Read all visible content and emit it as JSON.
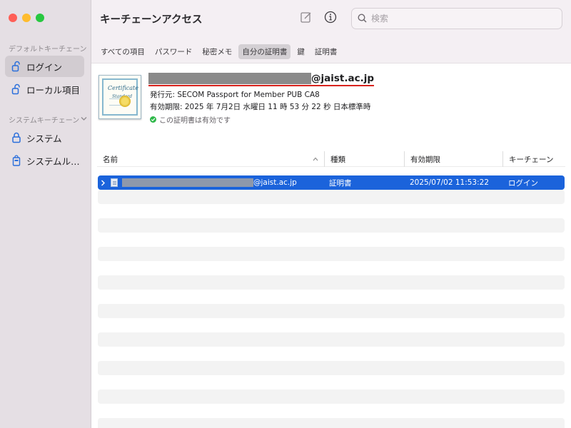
{
  "window": {
    "title": "キーチェーンアクセス",
    "traffic_lights": [
      "close",
      "minimize",
      "maximize"
    ]
  },
  "sidebar": {
    "sections": [
      {
        "title": "デフォルトキーチェーン",
        "items": [
          {
            "label": "ログイン",
            "icon": "unlocked-padlock-icon",
            "selected": true
          },
          {
            "label": "ローカル項目",
            "icon": "unlocked-padlock-icon",
            "selected": false
          }
        ]
      },
      {
        "title": "システムキーチェーン",
        "collapse_icon": "chevron-down-icon",
        "items": [
          {
            "label": "システム",
            "icon": "locked-padlock-icon",
            "selected": false
          },
          {
            "label": "システムル…",
            "icon": "locked-cabinet-icon",
            "selected": false
          }
        ]
      }
    ]
  },
  "toolbar": {
    "compose_icon": "compose-icon",
    "info_icon": "info-icon",
    "search_placeholder": "検索",
    "search_value": ""
  },
  "tabs": [
    {
      "label": "すべての項目",
      "selected": false
    },
    {
      "label": "パスワード",
      "selected": false
    },
    {
      "label": "秘密メモ",
      "selected": false
    },
    {
      "label": "自分の証明書",
      "selected": true
    },
    {
      "label": "鍵",
      "selected": false
    },
    {
      "label": "証明書",
      "selected": false
    }
  ],
  "detail": {
    "subject_suffix": "@jaist.ac.jp",
    "issuer": "発行元: SECOM Passport for Member PUB CA8",
    "expiry": "有効期限: 2025 年 7月2日 水曜日 11 時 53 分 22 秒 日本標準時",
    "status": "この証明書は有効です",
    "thumbnail_text": {
      "line1": "Certificate",
      "line2": "Standard"
    }
  },
  "table": {
    "columns": [
      {
        "label": "名前",
        "sort": "ascending"
      },
      {
        "label": "種類"
      },
      {
        "label": "有効期限"
      },
      {
        "label": "キーチェーン"
      }
    ],
    "rows": [
      {
        "name_suffix": "@jaist.ac.jp",
        "kind": "証明書",
        "expires": "2025/07/02 11:53:22",
        "keychain": "ログイン",
        "selected": true
      }
    ],
    "empty_stripe_rows": 17
  },
  "colors": {
    "selection": "#1b63db",
    "sidebar_bg": "#e5dfe4",
    "window_bg": "#f4eff3",
    "valid_check": "#2fb84a",
    "annotation_underline": "#d8231d",
    "redaction": "#8a8a8a"
  }
}
